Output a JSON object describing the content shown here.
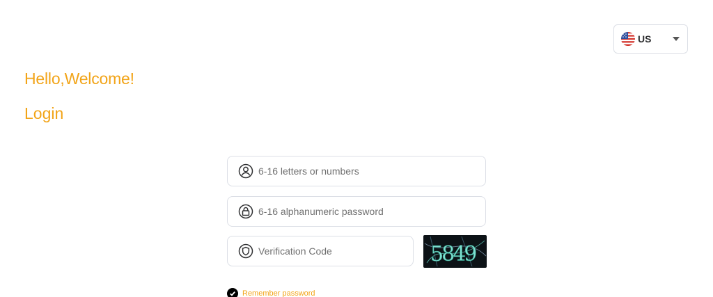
{
  "language": {
    "label": "US",
    "flag_icon": "us-flag-icon"
  },
  "header": {
    "greeting": "Hello,Welcome!",
    "title": "Login"
  },
  "form": {
    "username": {
      "value": "",
      "placeholder": "6-16 letters or numbers",
      "icon": "user-icon"
    },
    "password": {
      "value": "",
      "placeholder": "6-16 alphanumeric password",
      "icon": "lock-icon"
    },
    "verification": {
      "value": "",
      "placeholder": "Verification Code",
      "icon": "shield-icon"
    },
    "captcha": {
      "text": "5849"
    },
    "remember": {
      "label": "Remember password",
      "checked": true
    }
  },
  "colors": {
    "accent": "#f2a418",
    "border": "#dcdfe6",
    "captcha_bg": "#0c1216",
    "captcha_text": "#7ee0d0"
  }
}
